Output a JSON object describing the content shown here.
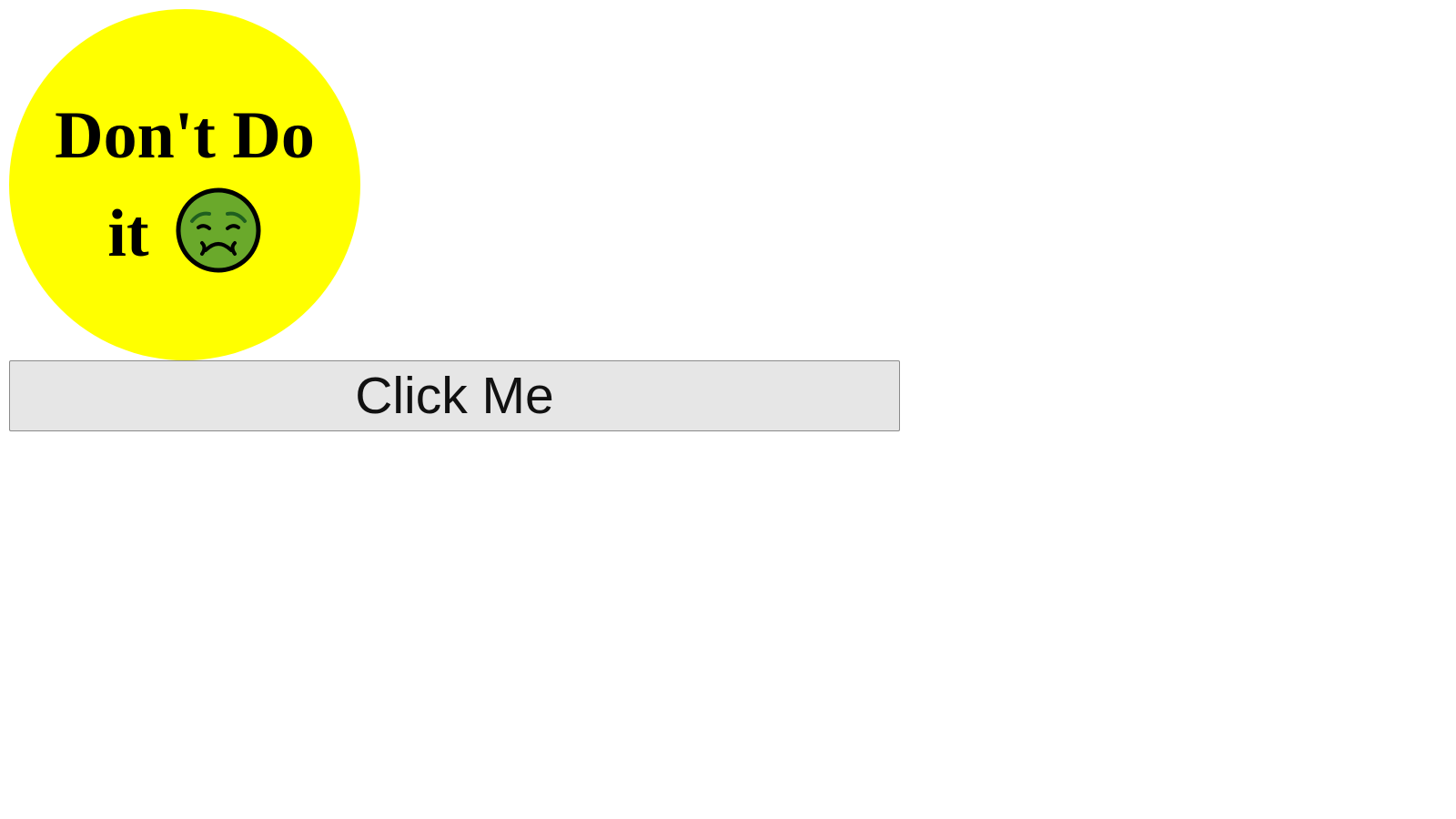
{
  "badge": {
    "line1": "Don't Do",
    "line2": "it",
    "emoji_icon": "nauseated-face-icon",
    "background_color": "#ffff00"
  },
  "button": {
    "label": "Click Me",
    "background_color": "#e6e6e6"
  }
}
